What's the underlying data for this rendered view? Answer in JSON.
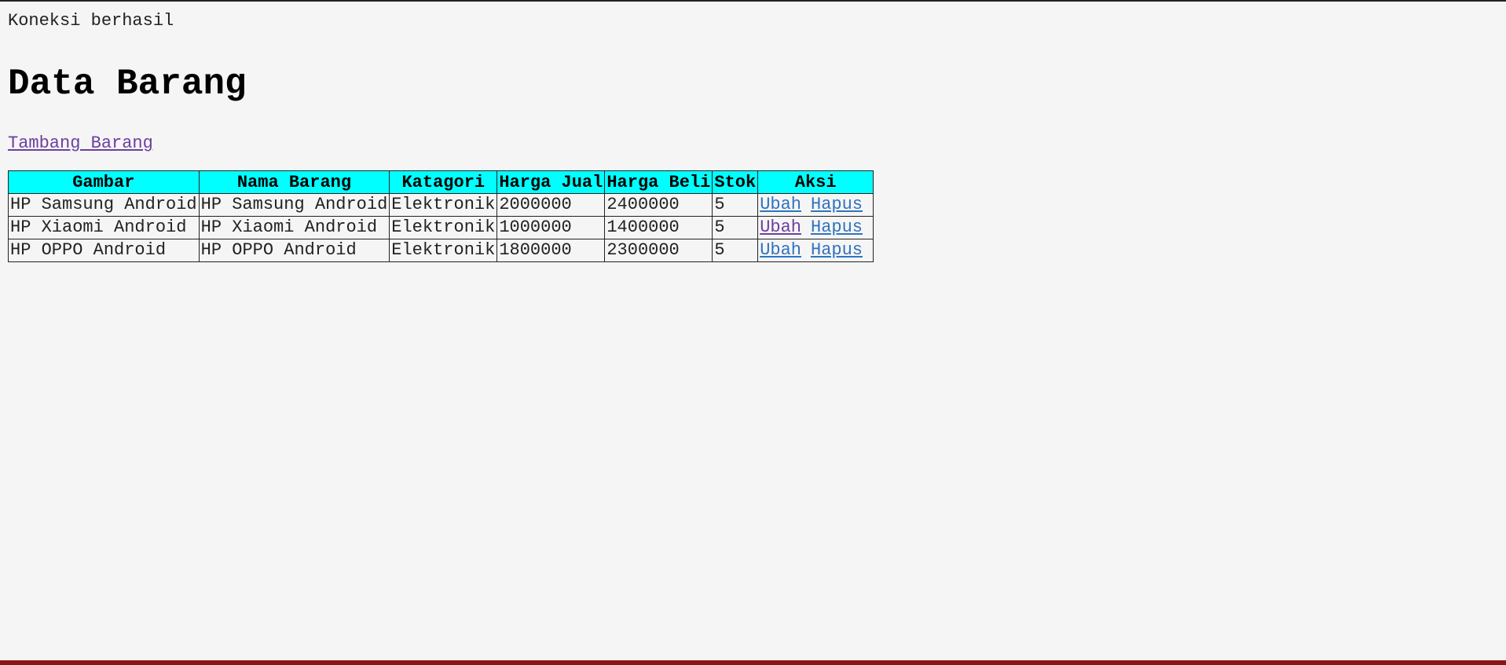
{
  "status_text": "Koneksi berhasil",
  "page_title": "Data Barang",
  "add_link_label": "Tambang Barang",
  "table": {
    "headers": [
      "Gambar",
      "Nama Barang",
      "Katagori",
      "Harga Jual",
      "Harga Beli",
      "Stok",
      "Aksi"
    ],
    "rows": [
      {
        "gambar": "HP Samsung Android",
        "nama": "HP Samsung Android",
        "kategori": "Elektronik",
        "harga_jual": "2000000",
        "harga_beli": "2400000",
        "stok": "5",
        "edit_label": "Ubah",
        "delete_label": "Hapus",
        "edit_visited": false
      },
      {
        "gambar": "HP Xiaomi Android",
        "nama": "HP Xiaomi Android",
        "kategori": "Elektronik",
        "harga_jual": "1000000",
        "harga_beli": "1400000",
        "stok": "5",
        "edit_label": "Ubah",
        "delete_label": "Hapus",
        "edit_visited": true
      },
      {
        "gambar": "HP OPPO Android",
        "nama": "HP OPPO Android",
        "kategori": "Elektronik",
        "harga_jual": "1800000",
        "harga_beli": "2300000",
        "stok": "5",
        "edit_label": "Ubah",
        "delete_label": "Hapus",
        "edit_visited": false
      }
    ]
  },
  "colors": {
    "header_bg": "#00ffff",
    "link": "#2f73c0",
    "visited_link": "#6c3fa0",
    "bottom_bar": "#8b1414"
  }
}
